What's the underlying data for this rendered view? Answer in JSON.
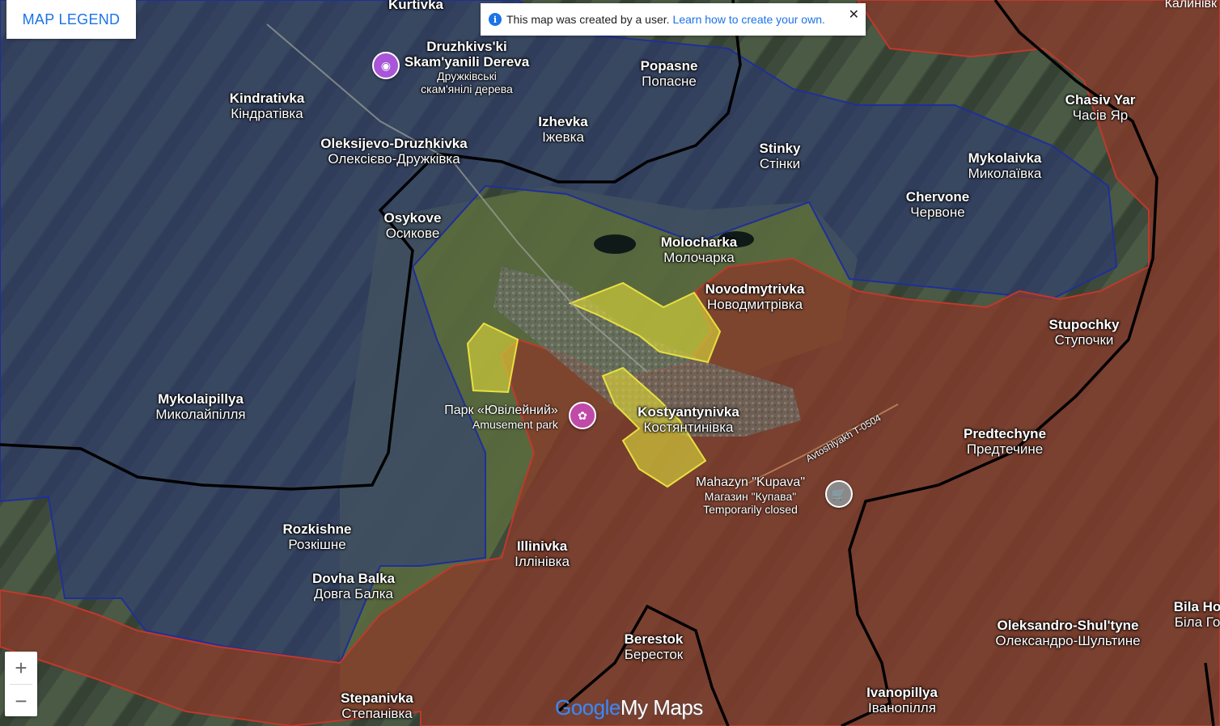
{
  "legend_button": "MAP LEGEND",
  "banner": {
    "info_icon": "i",
    "text": "This map was created by a user.",
    "link": "Learn how to create your own.",
    "close": "✕"
  },
  "zoom": {
    "in": "+",
    "out": "−"
  },
  "brand": {
    "google": "Google",
    "mymaps": "My Maps"
  },
  "places": [
    {
      "lat": "Kurtivka",
      "cyr": ""
    },
    {
      "lat": "Kindrativka",
      "cyr": "Кіндратівка"
    },
    {
      "lat": "Oleksijevo-Druzhkivka",
      "cyr": "Олексієво-Дружківка"
    },
    {
      "lat": "Osykove",
      "cyr": "Осикове"
    },
    {
      "lat": "Izhevka",
      "cyr": "Іжевка"
    },
    {
      "lat": "Popasne",
      "cyr": "Попасне"
    },
    {
      "lat": "Stinky",
      "cyr": "Стінки"
    },
    {
      "lat": "Chasiv Yar",
      "cyr": "Часів Яр"
    },
    {
      "lat": "Mykolaivka",
      "cyr": "Миколаївка"
    },
    {
      "lat": "Chervone",
      "cyr": "Червоне"
    },
    {
      "lat": "Molocharka",
      "cyr": "Молочарка"
    },
    {
      "lat": "Novodmytrivka",
      "cyr": "Новодмитрівка"
    },
    {
      "lat": "Stupochky",
      "cyr": "Ступочки"
    },
    {
      "lat": "Mykolaipillya",
      "cyr": "Миколайпілля"
    },
    {
      "lat": "Kostyantynivka",
      "cyr": "Костянтинівка"
    },
    {
      "lat": "Predtechyne",
      "cyr": "Предтечине"
    },
    {
      "lat": "Rozkishne",
      "cyr": "Розкішне"
    },
    {
      "lat": "Illinivka",
      "cyr": "Іллінівка"
    },
    {
      "lat": "Dovha Balka",
      "cyr": "Довга Балка"
    },
    {
      "lat": "Berestok",
      "cyr": "Бересток"
    },
    {
      "lat": "Oleksandro-Shul'tyne",
      "cyr": "Олександро-Шультине"
    },
    {
      "lat": "Bila Ho",
      "cyr": "Біла Го"
    },
    {
      "lat": "Ivanopillya",
      "cyr": "Іванопілля"
    },
    {
      "lat": "Stepanivka",
      "cyr": "Степанівка"
    }
  ],
  "pois": {
    "druzhkivski": {
      "line1": "Druzhkivs'ki",
      "line2": "Skam'yanili Dereva",
      "line3": "Дружківські",
      "line4": "скам'янілі дерева",
      "icon": "camera-icon"
    },
    "park": {
      "line1": "Парк «Ювілейний»",
      "line2": "Amusement park",
      "icon": "amusement-park-icon"
    },
    "kupava": {
      "line1": "Mahazyn \"Kupava\"",
      "line2": "Магазин \"Купава\"",
      "line3": "Temporarily closed",
      "icon": "shopping-cart-icon"
    }
  },
  "road_label": "Avtoshlyakh T-0504",
  "corner_label": "Калинівк",
  "colors": {
    "occupied_fill": "#8b3a2a",
    "occupied_border": "#c0392b",
    "liberated_fill": "#2c3a7a",
    "liberated_border": "#1f2f9a",
    "contested_fill": "#d8d43a",
    "contested_border": "#e8e040",
    "oblast_border": "#000000"
  }
}
